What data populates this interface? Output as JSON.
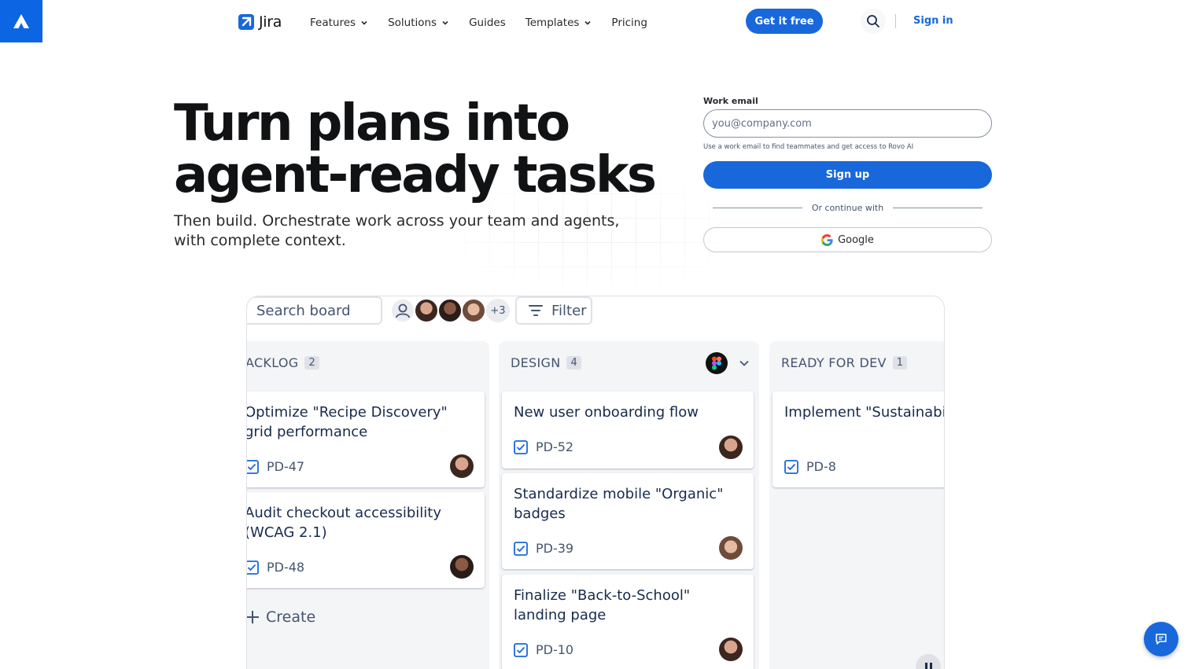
{
  "header": {
    "brand_name": "Jira",
    "nav": [
      {
        "label": "Features",
        "has_dropdown": true
      },
      {
        "label": "Solutions",
        "has_dropdown": true
      },
      {
        "label": "Guides",
        "has_dropdown": false
      },
      {
        "label": "Templates",
        "has_dropdown": true
      },
      {
        "label": "Pricing",
        "has_dropdown": false
      }
    ],
    "cta_label": "Get it free",
    "signin_label": "Sign in"
  },
  "hero": {
    "title_line1": "Turn plans into",
    "title_line2": "agent-ready tasks",
    "subtitle": "Then build. Orchestrate work across your team and agents, with complete context."
  },
  "signup": {
    "email_label": "Work email",
    "email_placeholder": "you@company.com",
    "email_value": "",
    "hint": "Use a work email to find teammates and get access to Rovo AI",
    "submit_label": "Sign up",
    "divider_text": "Or continue with",
    "google_label": "Google"
  },
  "board": {
    "search_placeholder": "Search board",
    "avatar_more": "+3",
    "filter_label": "Filter",
    "create_label": "Create",
    "columns": [
      {
        "name": "ACKLOG",
        "count": "2",
        "cards": [
          {
            "title": "Optimize \"Recipe Discovery\" grid performance",
            "key": "PD-47"
          },
          {
            "title": "Audit checkout accessibility (WCAG 2.1)",
            "key": "PD-48"
          }
        ]
      },
      {
        "name": "DESIGN",
        "count": "4",
        "cards": [
          {
            "title": "New user onboarding flow",
            "key": "PD-52"
          },
          {
            "title": "Standardize mobile \"Organic\" badges",
            "key": "PD-39"
          },
          {
            "title": "Finalize \"Back-to-School\" landing page",
            "key": "PD-10"
          }
        ]
      },
      {
        "name": "READY FOR DEV",
        "count": "1",
        "cards": [
          {
            "title": "Implement \"Sustainability\" video streaming",
            "key": "PD-8"
          }
        ]
      }
    ]
  },
  "colors": {
    "primary": "#1868db",
    "atlassian_logo_bg": "#0c66e4",
    "text_dark": "#101214",
    "column_bg": "#f4f5f7"
  }
}
